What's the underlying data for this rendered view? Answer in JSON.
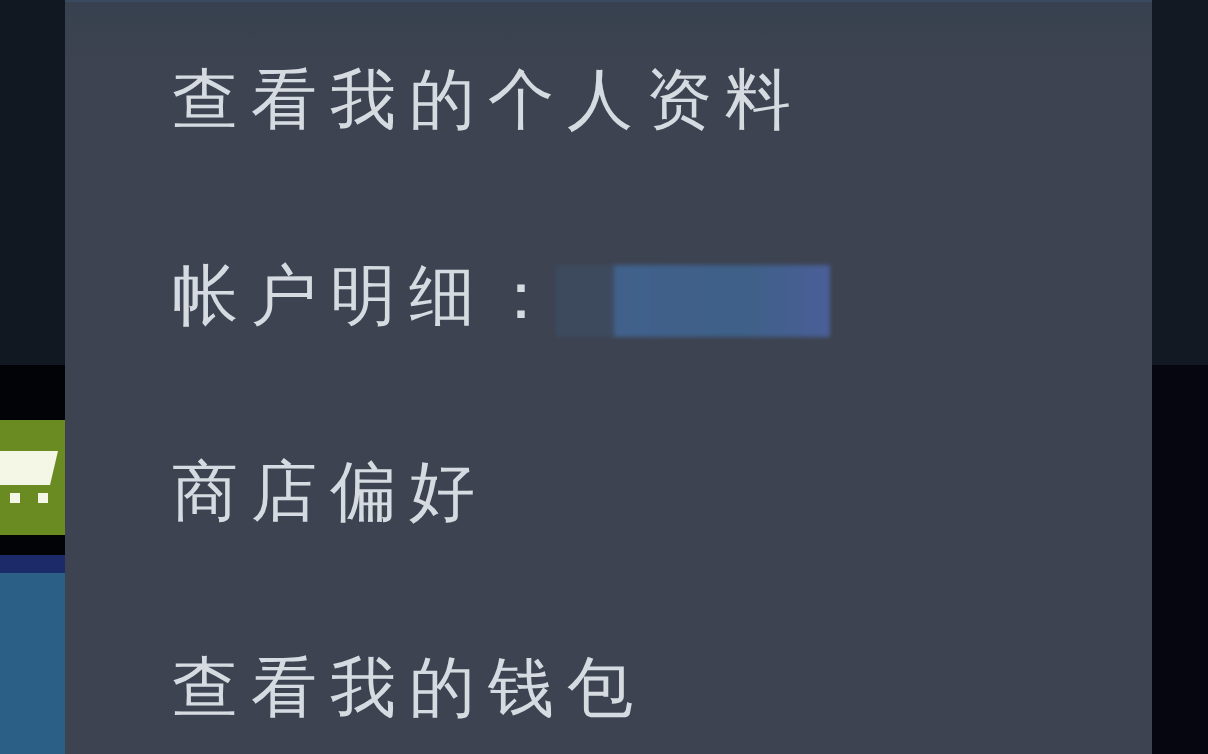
{
  "menu": {
    "items": [
      {
        "kind": "link",
        "label": "查看我的个人资料"
      },
      {
        "kind": "account",
        "label": "帐户明细："
      },
      {
        "kind": "link",
        "label": "商店偏好"
      },
      {
        "kind": "link",
        "label": "查看我的钱包"
      }
    ]
  }
}
